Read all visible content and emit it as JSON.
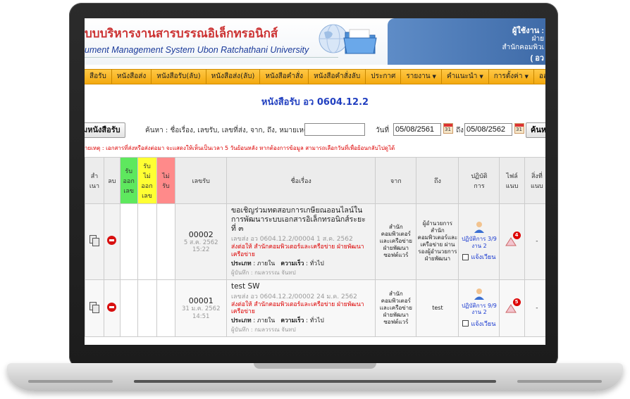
{
  "header": {
    "title_th": "บบบริหารงานสารบรรณอิเล็กทรอนิกส์",
    "title_en": "ument Management System Ubon Ratchathani University",
    "user_label": "ผู้ใช้งาน :",
    "user_line2": "ฝ่าย",
    "user_line3": "สำนักคอมพิวเ",
    "user_line4": "( อว"
  },
  "nav": {
    "items": [
      {
        "label": "สือรับ"
      },
      {
        "label": "หนังสือส่ง"
      },
      {
        "label": "หนังสือรับ(ลับ)"
      },
      {
        "label": "หนังสือส่ง(ลับ)"
      },
      {
        "label": "หนังสือคำสั่ง"
      },
      {
        "label": "หนังสือคำสั่งลับ"
      },
      {
        "label": "ประกาศ"
      },
      {
        "label": "รายงาน",
        "caret": "▼"
      },
      {
        "label": "คำแนะนำ",
        "caret": "▼"
      },
      {
        "label": "การตั้งค่า",
        "caret": "▼"
      },
      {
        "label": "ออ"
      }
    ]
  },
  "page": {
    "heading": "หนังสือรับ อว 0604.12.2"
  },
  "toolbar": {
    "add_button": "มหนังสือรับ",
    "search_label": "ค้นหา : ชื่อเรื่อง, เลขรับ, เลขที่ส่ง, จาก, ถึง, หมายเหตุ",
    "search_value": "",
    "date_from_label": "วันที่",
    "date_from": "05/08/2561",
    "date_to_label": "ถึง",
    "date_to": "05/08/2562",
    "search_button": "ค้นห"
  },
  "note": "ายเหตุ : เอกสารที่ส่งหรือส่งต่อมา จะแสดงให้เห็นเป็นเวลา 5 วันย้อนหลัง หากต้องการข้อมูล สามารถเลือกวันที่เพื่อย้อนกลับไปดูได้",
  "table": {
    "headers": {
      "copy": "สำ\nเนา",
      "del": "ลบ",
      "recv_out": "รับ\nออก\nเลข",
      "recv_no_out": "รับ\nไม่\nออก\nเลข",
      "not_recv": "ไม่\nรับ",
      "recv_no": "เลขรับ",
      "subject": "ชื่อเรื่อง",
      "from": "จาก",
      "to": "ถึง",
      "action": "ปฏิบัติ\nการ",
      "file": "ไฟล์\nแนบ",
      "item": "สิ่งที่\nแนบ"
    },
    "rows": [
      {
        "recv_no": "00002",
        "recv_date": "5 ส.ค. 2562",
        "recv_time": "15:22",
        "subject": "ขอเชิญร่วมทดสอบการเกษียณออนไลน์ในการพัฒนาระบบเอกสารอิเล็กทรอนิกส์ระยะ ที่ ๓",
        "ref": "เลขส่ง อว 0604.12.2/00004    1 ส.ค. 2562",
        "sent_to": "ส่งต่อให้  สำนักคอมพิวเตอร์และเครือข่าย ฝ่ายพัฒนาเครือข่าย",
        "type_label": "ประเภท",
        "type_value": ": ภายใน",
        "urgency_label": "ความเร็ว",
        "urgency_value": ": ทั่วไป",
        "recorder": "ผู้บันทึก : กมลวรรณ จันทป",
        "from": "สำนักคอมพิวเตอร์และเครือข่าย ฝ่ายพัฒนาซอฟต์แวร์",
        "to": "ผู้อำนวยการสำนักคอมพิวเตอร์และเครือข่าย ผ่านรองผู้อำนวยการฝ่ายพัฒนา",
        "action_link": "ปฏิบัติการ 3/9 งาน 2",
        "circulate": "แจ้งเวียน",
        "badge": "4",
        "item": "-"
      },
      {
        "recv_no": "00001",
        "recv_date": "31 ม.ค. 2562",
        "recv_time": "14:51",
        "subject": "test SW",
        "ref": "เลขส่ง อว 0604.12.2/00002    24 ม.ค. 2562",
        "sent_to": "ส่งต่อให้  สำนักคอมพิวเตอร์และเครือข่าย ฝ่ายพัฒนาเครือข่าย",
        "type_label": "ประเภท",
        "type_value": ": ภายใน",
        "urgency_label": "ความเร็ว",
        "urgency_value": ": ทั่วไป",
        "recorder": "ผู้บันทึก : กมลวรรณ จันทป",
        "from": "สำนักคอมพิวเตอร์และเครือข่าย ฝ่ายพัฒนาซอฟต์แวร์",
        "to": "test",
        "action_link": "ปฏิบัติการ 9/9 งาน 2",
        "circulate": "แจ้งเวียน",
        "badge": "5",
        "item": "-"
      }
    ]
  },
  "colors": {
    "nav_bg": "#f8b62a",
    "heading_blue": "#2240c0",
    "title_red": "#cc3333",
    "col_green": "#5ee85e",
    "col_yellow": "#ffff33",
    "col_pink": "#ff8a8a"
  }
}
